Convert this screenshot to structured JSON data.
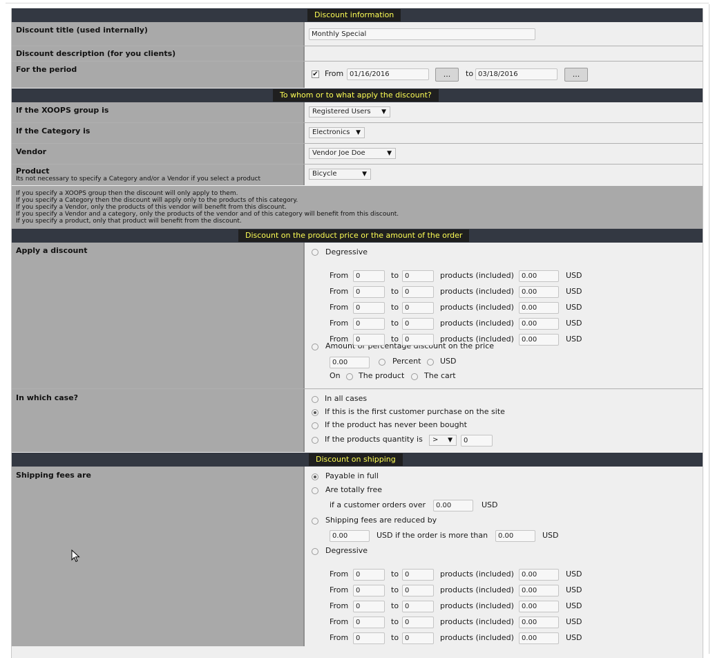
{
  "discount_info": {
    "header": "Discount information",
    "title_label": "Discount title (used internally)",
    "title_value": "Monthly Special",
    "description_label": "Discount description (for you clients)",
    "period_label": "For the period",
    "period_from_label": "From",
    "period_from_value": "01/16/2016",
    "period_to_label": "to",
    "period_to_value": "03/18/2016",
    "picker_label": "...",
    "period_checked": true
  },
  "apply_to": {
    "header": "To whom or to what apply the discount?",
    "group_label": "If the XOOPS group is",
    "group_value": "Registered Users",
    "category_label": "If the Category is",
    "category_value": "Electronics",
    "vendor_label": "Vendor",
    "vendor_value": "Vendor Joe Doe",
    "product_label": "Product",
    "product_sub": "Its not necessary to specify a Category and/or a Vendor if you select a product",
    "product_value": "Bicycle",
    "notes": [
      "If you specify a XOOPS group then the discount will only apply to them.",
      "If you specify a Category then the discount will apply only to the products of this category.",
      "If you specify a Vendor, only the products of this vendor will benefit from this discount.",
      "If you specify a Vendor and a category, only the products of the vendor and of this category will benefit from this discount.",
      "If you specify a product, only that product will benefit from the discount."
    ]
  },
  "product_discount": {
    "header": "Discount on the product price or the amount of the order",
    "apply_label": "Apply a discount",
    "degressive_label": "Degressive",
    "from_label": "From",
    "to_label": "to",
    "products_included_label": "products (included)",
    "currency": "USD",
    "tiers": [
      {
        "from": "0",
        "to": "0",
        "amount": "0.00"
      },
      {
        "from": "0",
        "to": "0",
        "amount": "0.00"
      },
      {
        "from": "0",
        "to": "0",
        "amount": "0.00"
      },
      {
        "from": "0",
        "to": "0",
        "amount": "0.00"
      },
      {
        "from": "0",
        "to": "0",
        "amount": "0.00"
      }
    ],
    "amount_pct_label": "Amount or percentage discount on the price",
    "amount_value": "0.00",
    "percent_label": "Percent",
    "usd_label": "USD",
    "on_label": "On",
    "the_product_label": "The product",
    "the_cart_label": "The cart",
    "case_label": "In which case?",
    "case_all": "In all cases",
    "case_first": "If this is the first customer purchase on the site",
    "case_never": "If the product has never been bought",
    "case_quantity": "If the products quantity is",
    "quantity_operator": ">",
    "quantity_value": "0",
    "case_selected": "first"
  },
  "shipping": {
    "header": "Discount on shipping",
    "fees_label": "Shipping fees are",
    "payable_full": "Payable in full",
    "totally_free": "Are totally free",
    "if_orders_over": "if a customer orders over",
    "free_threshold": "0.00",
    "currency": "USD",
    "reduced_by": "Shipping fees are reduced by",
    "reduced_value": "0.00",
    "usd_if_more_than": "USD if the order is more than",
    "reduced_threshold": "0.00",
    "degressive_label": "Degressive",
    "from_label": "From",
    "to_label": "to",
    "products_included_label": "products (included)",
    "tiers": [
      {
        "from": "0",
        "to": "0",
        "amount": "0.00"
      },
      {
        "from": "0",
        "to": "0",
        "amount": "0.00"
      },
      {
        "from": "0",
        "to": "0",
        "amount": "0.00"
      },
      {
        "from": "0",
        "to": "0",
        "amount": "0.00"
      },
      {
        "from": "0",
        "to": "0",
        "amount": "0.00"
      }
    ],
    "selected": "payable"
  }
}
